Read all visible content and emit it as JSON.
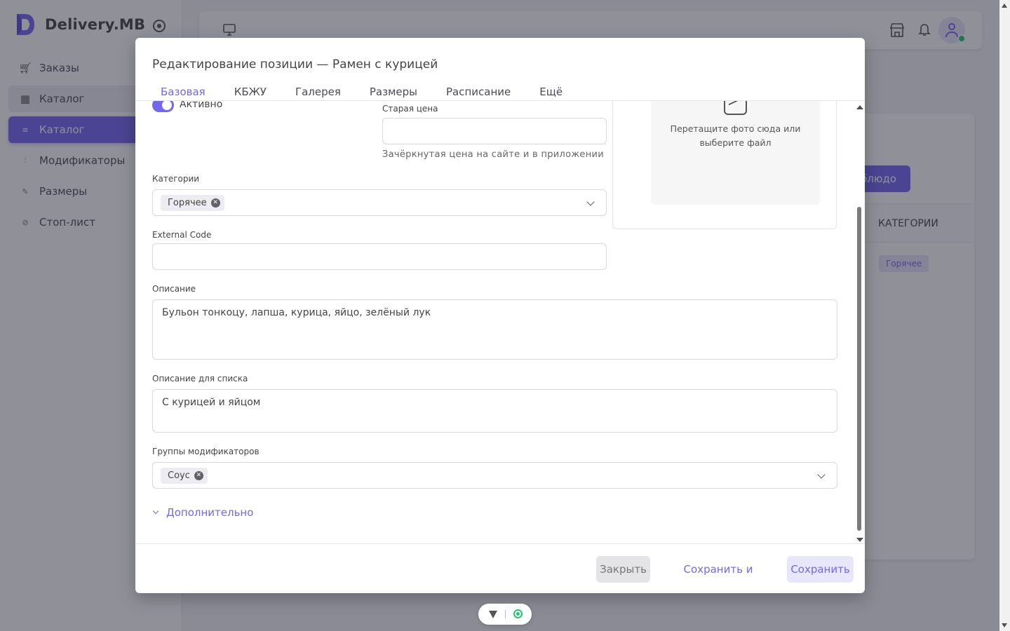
{
  "app": {
    "name": "Delivery.MB"
  },
  "sidebar": {
    "items": [
      {
        "label": "Заказы",
        "icon": "cart-icon"
      },
      {
        "label": "Каталог",
        "icon": "grid-icon"
      },
      {
        "label": "Каталог",
        "icon": "list-icon"
      },
      {
        "label": "Модификаторы",
        "icon": "sliders-icon"
      },
      {
        "label": "Размеры",
        "icon": "ruler-icon"
      },
      {
        "label": "Стоп-лист",
        "icon": "block-icon"
      }
    ]
  },
  "background": {
    "add_button_label": "блюдо",
    "column_header": "КАТЕГОРИИ",
    "row_category": "Горячее"
  },
  "modal": {
    "title": "Редактирование позиции — Рамен с курицей",
    "tabs": [
      "Базовая",
      "КБЖУ",
      "Галерея",
      "Размеры",
      "Расписание",
      "Ещё"
    ],
    "active_tab": "Базовая",
    "active_toggle_label": "Активно",
    "old_price": {
      "label": "Старая цена",
      "value": "",
      "hint": "Зачёркнутая цена на сайте и в приложении"
    },
    "photo": {
      "text": "Перетащите фото сюда или выберите файл"
    },
    "categories": {
      "label": "Категории",
      "selected": "Горячее"
    },
    "external_code": {
      "label": "External Code",
      "value": ""
    },
    "description": {
      "label": "Описание",
      "value": "Бульон тонкоцу, лапша, курица, яйцо, зелёный лук"
    },
    "list_description": {
      "label": "Описание для списка",
      "value": "С курицей и яйцом"
    },
    "modifier_groups": {
      "label": "Группы модификаторов",
      "selected": "Соус"
    },
    "more_link": "Дополнительно",
    "footer": {
      "close": "Закрыть",
      "save_close": "Сохранить и закрыть",
      "save": "Сохранить"
    }
  },
  "colors": {
    "accent": "#7367f0",
    "online": "#28c76f"
  }
}
